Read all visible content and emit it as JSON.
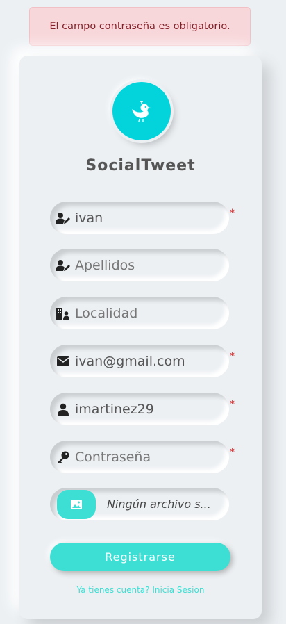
{
  "alert": {
    "message": "El campo contraseña es obligatorio."
  },
  "brand": {
    "name": "SocialTweet",
    "logo_icon": "bird-icon",
    "logo_color": "#03d4dc"
  },
  "form": {
    "nombre": {
      "value": "ivan",
      "icon": "user-edit-icon",
      "required": "*"
    },
    "apellidos": {
      "placeholder": "Apellidos",
      "icon": "user-edit-icon"
    },
    "localidad": {
      "placeholder": "Localidad",
      "icon": "city-icon"
    },
    "email": {
      "value": "ivan@gmail.com",
      "icon": "envelope-icon",
      "required": "*"
    },
    "usuario": {
      "value": "imartinez29",
      "icon": "user-icon",
      "required": "*"
    },
    "password": {
      "placeholder": "Contraseña",
      "icon": "key-icon",
      "required": "*"
    },
    "avatar": {
      "file_label": "Ningún archivo s...",
      "icon": "image-icon"
    }
  },
  "submit_label": "Registrarse",
  "login_link": "Ya tienes cuenta? Inicia Sesion",
  "colors": {
    "accent": "#3ddfd4",
    "background": "#ecf0f3",
    "alert_bg": "#f8d7da",
    "alert_text": "#842029"
  }
}
